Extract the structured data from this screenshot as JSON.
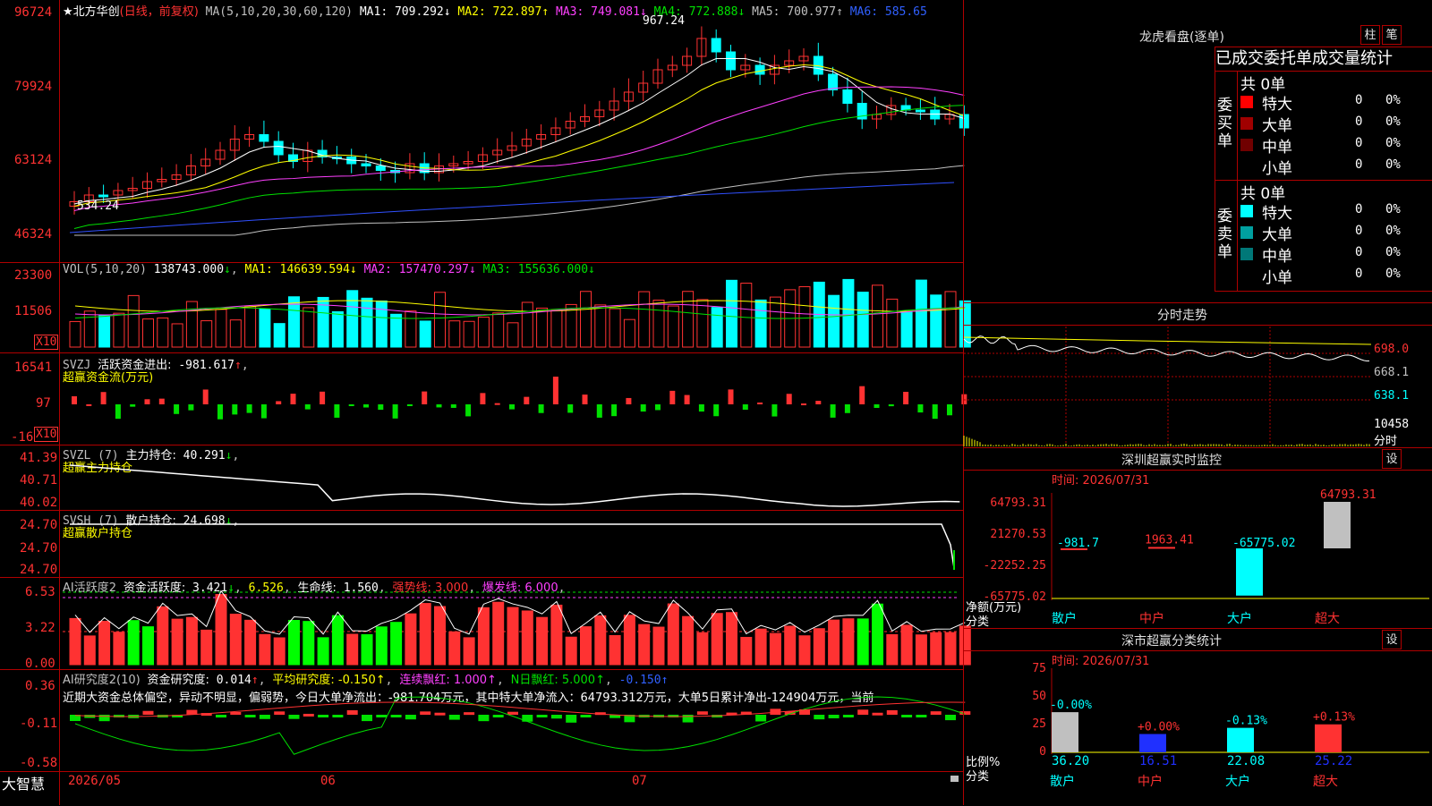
{
  "colors": {
    "up": "#ff3232",
    "down": "#00ffff",
    "bg": "#000000",
    "frame": "#b00000",
    "ma1": "#ffffff",
    "ma2": "#ffff00",
    "ma3": "#ff40ff",
    "ma4": "#00e000",
    "ma5": "#c0c0c0",
    "ma6": "#3050ff"
  },
  "kline": {
    "title": "★北方华创",
    "mode": "(日线，前复权)",
    "ma_params": "MA(5,10,20,30,60,120)",
    "ma": [
      {
        "label": "MA1:",
        "value": "709.292",
        "arrow": "↓",
        "cls": "wht"
      },
      {
        "label": "MA2:",
        "value": "722.897",
        "arrow": "↑",
        "cls": "yel"
      },
      {
        "label": "MA3:",
        "value": "749.081",
        "arrow": "↓",
        "cls": "mag"
      },
      {
        "label": "MA4:",
        "value": "772.888",
        "arrow": "↓",
        "cls": "grn"
      },
      {
        "label": "MA5:",
        "value": "700.977",
        "arrow": "↑",
        "cls": "gry"
      },
      {
        "label": "MA6:",
        "value": "585.65",
        "arrow": "",
        "cls": "blu"
      }
    ],
    "yticks": [
      "96724",
      "79924",
      "63124",
      "46324"
    ],
    "high_label": "967.24",
    "low_label": "534.24"
  },
  "vol": {
    "name": "VOL(5,10,20)",
    "value": "138743.000",
    "arrow": "↓",
    "ma": [
      {
        "label": "MA1:",
        "value": "146639.594",
        "arrow": "↓",
        "cls": "yel"
      },
      {
        "label": "MA2:",
        "value": "157470.297",
        "arrow": "↓",
        "cls": "mag"
      },
      {
        "label": "MA3:",
        "value": "155636.000",
        "arrow": "↓",
        "cls": "grn"
      }
    ],
    "yticks": [
      "23300",
      "11506"
    ],
    "unit": "X10"
  },
  "svzj": {
    "name": "SVZJ",
    "label": "活跃资金进出:",
    "value": "-981.617",
    "arrow": "↑",
    "sub": "超赢资金流(万元)",
    "yticks": [
      "16541",
      "97",
      "-16"
    ],
    "unit": "X10"
  },
  "svzl": {
    "name": "SVZL (7)",
    "label": "主力持仓:",
    "value": "40.291",
    "arrow": "↓",
    "sub": "超赢主力持仓",
    "yticks": [
      "41.39",
      "40.71",
      "40.02"
    ]
  },
  "svsh": {
    "name": "SVSH (7)",
    "label": "散户持仓:",
    "value": "24.698",
    "arrow": "↓",
    "sub": "超赢散户持仓",
    "yticks": [
      "24.70",
      "24.70",
      "24.70"
    ]
  },
  "ai_active": {
    "name": "AI活跃度2",
    "label": "资金活跃度:",
    "value": "3.421",
    "arrow": "↓",
    "v2": "6.526",
    "life_label": "生命线:",
    "life": "1.560",
    "strong": "强势线: 3.000",
    "burst": "爆发线: 6.000",
    "yticks": [
      "6.53",
      "3.22",
      "0.00"
    ]
  },
  "ai_research": {
    "name": "AI研究度2(10)",
    "label": "资金研究度:",
    "value": "0.014",
    "arrow": "↑",
    "avg": "平均研究度: -0.150↑",
    "red": "连续飘红: 1.000↑",
    "n": "N日飘红: 5.000↑",
    "extra": "-0.150↑",
    "text": "近期大资金总体偏空，异动不明显，偏弱势，今日大单净流出：-981.704万元，其中特大单净流入：64793.312万元，大单5日累计净出-124904万元，当前",
    "yticks": [
      "0.36",
      "-0.11",
      "-0.58"
    ]
  },
  "footer": {
    "logo": "大智慧",
    "dates": [
      "2026/05",
      "06",
      "07"
    ]
  },
  "dragon": {
    "title": "龙虎看盘(逐单)",
    "btn1": "柱",
    "btn2": "笔",
    "tabs": [
      "已成交",
      "委托单",
      "成交量",
      "统计"
    ],
    "buy": {
      "side": "委买单",
      "total": "共 0单",
      "rows": [
        {
          "label": "特大",
          "n": "0",
          "p": "0%",
          "color": "#ff0000"
        },
        {
          "label": "大单",
          "n": "0",
          "p": "0%",
          "color": "#a00000"
        },
        {
          "label": "中单",
          "n": "0",
          "p": "0%",
          "color": "#700000"
        },
        {
          "label": "小单",
          "n": "0",
          "p": "0%",
          "color": ""
        }
      ]
    },
    "sell": {
      "side": "委卖单",
      "total": "共 0单",
      "rows": [
        {
          "label": "特大",
          "n": "0",
          "p": "0%",
          "color": "#00ffff"
        },
        {
          "label": "大单",
          "n": "0",
          "p": "0%",
          "color": "#00a0a0"
        },
        {
          "label": "中单",
          "n": "0",
          "p": "0%",
          "color": "#007878"
        },
        {
          "label": "小单",
          "n": "0",
          "p": "0%",
          "color": ""
        }
      ]
    }
  },
  "intraday": {
    "title": "分时走势",
    "yticks": [
      "698.0",
      "668.1",
      "638.1",
      "10458"
    ],
    "unit": "分时"
  },
  "sz_monitor": {
    "title": "深圳超赢实时监控",
    "btn": "设",
    "time": "时间: 2026/07/31",
    "yticks": [
      "64793.31",
      "21270.53",
      "-22252.25",
      "-65775.02"
    ],
    "ylab1": "净额(万元)",
    "ylab2": "分类",
    "bars": [
      {
        "cat": "散户",
        "value": -981.7,
        "label": "-981.7"
      },
      {
        "cat": "中户",
        "value": 1963.41,
        "label": "1963.41"
      },
      {
        "cat": "大户",
        "value": -65775.02,
        "label": "-65775.02"
      },
      {
        "cat": "超大",
        "value": 64793.31,
        "label": "64793.31"
      }
    ]
  },
  "sh_stat": {
    "title": "深市超赢分类统计",
    "btn": "设",
    "time": "时间: 2026/07/31",
    "yticks": [
      "75",
      "50",
      "25",
      "0"
    ],
    "ylab1": "比例%",
    "ylab2": "分类",
    "bars": [
      {
        "cat": "散户",
        "value": 36.2,
        "label": "36.20",
        "chg": "-0.00%",
        "color": "#c0c0c0"
      },
      {
        "cat": "中户",
        "value": 16.51,
        "label": "16.51",
        "chg": "+0.00%",
        "color": "#2030ff"
      },
      {
        "cat": "大户",
        "value": 22.08,
        "label": "22.08",
        "chg": "-0.13%",
        "color": "#00ffff"
      },
      {
        "cat": "超大",
        "value": 25.22,
        "label": "25.22",
        "chg": "+0.13%",
        "color": "#ff3232"
      }
    ]
  }
}
